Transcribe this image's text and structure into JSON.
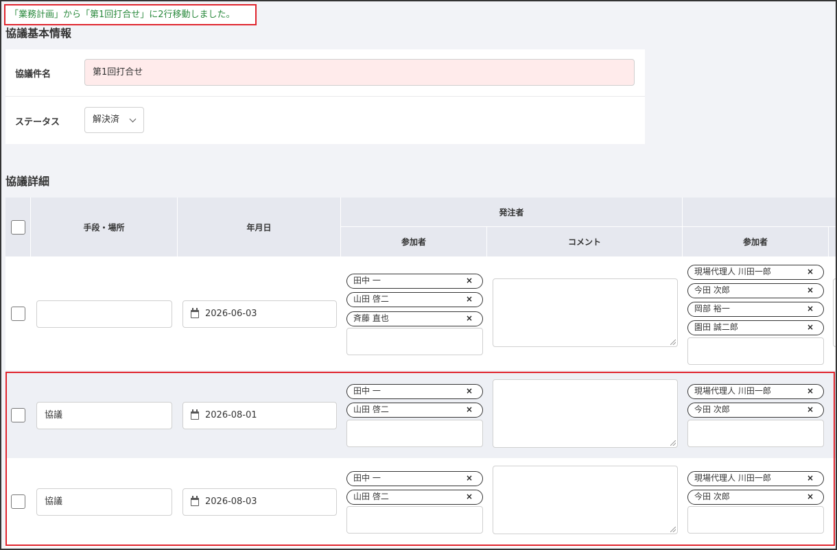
{
  "toast": "「業務計画」から「第1回打合せ」に2行移動しました。",
  "basic": {
    "section_title": "協議基本情報",
    "name_label": "協議件名",
    "name_value": "第1回打合せ",
    "status_label": "ステータス",
    "status_value": "解決済"
  },
  "details": {
    "section_title": "協議詳細",
    "headers": {
      "method_place": "手段・場所",
      "date": "年月日",
      "orderer": "発注者",
      "participants": "参加者",
      "comment": "コメント",
      "participants2": "参加者"
    },
    "rows": [
      {
        "method": "",
        "date": "2026-06-03",
        "orderer_participants": [
          "田中 一",
          "山田 啓二",
          "斉藤 直也"
        ],
        "contractor_participants": [
          "現場代理人 川田一郎",
          "今田 次郎",
          "岡部 裕一",
          "園田 誠二郎"
        ]
      },
      {
        "method": "協議",
        "date": "2026-08-01",
        "orderer_participants": [
          "田中 一",
          "山田 啓二"
        ],
        "contractor_participants": [
          "現場代理人 川田一郎",
          "今田 次郎"
        ]
      },
      {
        "method": "協議",
        "date": "2026-08-03",
        "orderer_participants": [
          "田中 一",
          "山田 啓二"
        ],
        "contractor_participants": [
          "現場代理人 川田一郎",
          "今田 次郎"
        ]
      }
    ],
    "remove_symbol": "×"
  },
  "colors": {
    "toast_text": "#2b8a3e",
    "highlight_border": "#e0232c",
    "name_input_bg": "#ffebeb",
    "header_bg": "#e6e8ef",
    "page_bg": "#f2f3f7"
  }
}
